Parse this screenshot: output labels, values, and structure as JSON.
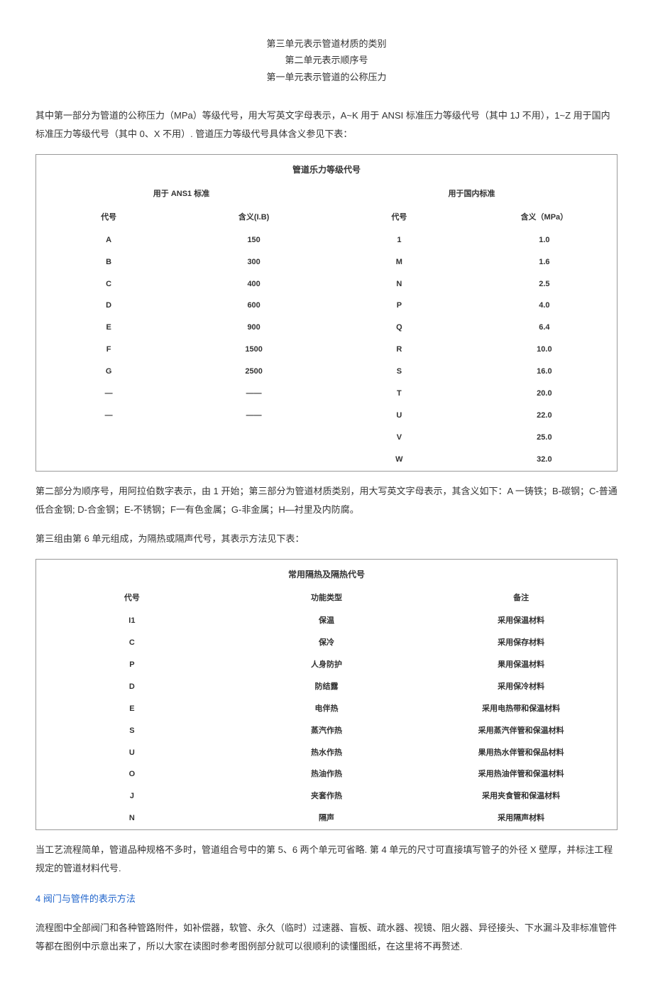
{
  "unit_lines": {
    "l1": "第三单元表示管道材质的类别",
    "l2": "第二单元表示顺序号",
    "l3": "第一单元表示管道的公称压力"
  },
  "para1": "其中第一部分为管道的公称压力（MPa）等级代号，用大写英文字母表示，A~K 用于 ANSI 标准压力等级代号（其中 1J 不用），1~Z 用于国内标准压力等级代号（其中 0、X 不用）. 管道压力等级代号具体含义参见下表：",
  "table1": {
    "title": "管道乐力等级代号",
    "group1": "用于 ANS1 标准",
    "group2": "用于国内标准",
    "h1": "代号",
    "h2": "含义(I.B)",
    "h3": "代号",
    "h4": "含义（MPa）",
    "rows": [
      {
        "c1": "A",
        "c2": "150",
        "c3": "1",
        "c4": "1.0"
      },
      {
        "c1": "B",
        "c2": "300",
        "c3": "M",
        "c4": "1.6"
      },
      {
        "c1": "C",
        "c2": "400",
        "c3": "N",
        "c4": "2.5"
      },
      {
        "c1": "D",
        "c2": "600",
        "c3": "P",
        "c4": "4.0"
      },
      {
        "c1": "E",
        "c2": "900",
        "c3": "Q",
        "c4": "6.4"
      },
      {
        "c1": "F",
        "c2": "1500",
        "c3": "R",
        "c4": "10.0"
      },
      {
        "c1": "G",
        "c2": "2500",
        "c3": "S",
        "c4": "16.0"
      },
      {
        "c1": "—",
        "c2": "——",
        "c3": "T",
        "c4": "20.0"
      },
      {
        "c1": "—",
        "c2": "——",
        "c3": "U",
        "c4": "22.0"
      },
      {
        "c1": "",
        "c2": "",
        "c3": "V",
        "c4": "25.0"
      },
      {
        "c1": "",
        "c2": "",
        "c3": "W",
        "c4": "32.0"
      }
    ]
  },
  "para2": "第二部分为顺序号，用阿拉伯数字表示，由 1 开始；第三部分为管道材质类别，用大写英文字母表示，其含义如下：A 一铸铁；B-碳钢；C-普通低合金钢; D-合金钢；E-不锈钢；F一有色金属；G-非金属；H—衬里及内防腐。",
  "para3": "第三组由第 6 单元组成，为隔热或隔声代号，其表示方法见下表：",
  "table2": {
    "title": "常用隔热及隔热代号",
    "h1": "代号",
    "h2": "功能类型",
    "h3": "备注",
    "rows": [
      {
        "c1": "I1",
        "c2": "保温",
        "c3": "采用保温材料"
      },
      {
        "c1": "C",
        "c2": "保冷",
        "c3": "采用保存材料"
      },
      {
        "c1": "P",
        "c2": "人身防护",
        "c3": "果用保温材料"
      },
      {
        "c1": "D",
        "c2": "防结露",
        "c3": "采用保冷材料"
      },
      {
        "c1": "E",
        "c2": "电伴热",
        "c3": "采用电热带和保温材料"
      },
      {
        "c1": "S",
        "c2": "蒸汽作热",
        "c3": "采用蒸汽伴管和保温材料"
      },
      {
        "c1": "U",
        "c2": "热水作热",
        "c3": "果用热水伴管和保品材料"
      },
      {
        "c1": "O",
        "c2": "热油作热",
        "c3": "采用热油伴管和保温材料"
      },
      {
        "c1": "J",
        "c2": "夹套作热",
        "c3": "采用夹食管和保温材料"
      },
      {
        "c1": "N",
        "c2": "隔声",
        "c3": "采用隔声材料"
      }
    ]
  },
  "para4": "当工艺流程简单，管道品种规格不多时，管道组合号中的第 5、6 两个单元可省略. 第 4 单元的尺寸可直接填写管子的外径 X 壁厚，并标注工程规定的管道材料代号.",
  "section4_title": "4 阀门与管件的表示方法",
  "para5": "流程图中全部阀门和各种管路附件，如补偿器，软管、永久（临时）过速器、盲板、疏水器、视镜、阻火器、异径接头、下水漏斗及非标准管件等都在图例中示意出来了，所以大家在读图时参考图例部分就可以很顺利的读懂图纸，在这里将不再赘述.",
  "chart_data": [
    {
      "type": "table",
      "title": "管道乐力等级代号",
      "columns": [
        "代号(ANS1)",
        "含义(I.B)",
        "代号(国内)",
        "含义(MPa)"
      ],
      "rows": [
        [
          "A",
          "150",
          "1",
          "1.0"
        ],
        [
          "B",
          "300",
          "M",
          "1.6"
        ],
        [
          "C",
          "400",
          "N",
          "2.5"
        ],
        [
          "D",
          "600",
          "P",
          "4.0"
        ],
        [
          "E",
          "900",
          "Q",
          "6.4"
        ],
        [
          "F",
          "1500",
          "R",
          "10.0"
        ],
        [
          "G",
          "2500",
          "S",
          "16.0"
        ],
        [
          "—",
          "——",
          "T",
          "20.0"
        ],
        [
          "—",
          "——",
          "U",
          "22.0"
        ],
        [
          "",
          "",
          "V",
          "25.0"
        ],
        [
          "",
          "",
          "W",
          "32.0"
        ]
      ]
    },
    {
      "type": "table",
      "title": "常用隔热及隔热代号",
      "columns": [
        "代号",
        "功能类型",
        "备注"
      ],
      "rows": [
        [
          "I1",
          "保温",
          "采用保温材料"
        ],
        [
          "C",
          "保冷",
          "采用保存材料"
        ],
        [
          "P",
          "人身防护",
          "果用保温材料"
        ],
        [
          "D",
          "防结露",
          "采用保冷材料"
        ],
        [
          "E",
          "电伴热",
          "采用电热带和保温材料"
        ],
        [
          "S",
          "蒸汽作热",
          "采用蒸汽伴管和保温材料"
        ],
        [
          "U",
          "热水作热",
          "果用热水伴管和保品材料"
        ],
        [
          "O",
          "热油作热",
          "采用热油伴管和保温材料"
        ],
        [
          "J",
          "夹套作热",
          "采用夹食管和保温材料"
        ],
        [
          "N",
          "隔声",
          "采用隔声材料"
        ]
      ]
    }
  ]
}
